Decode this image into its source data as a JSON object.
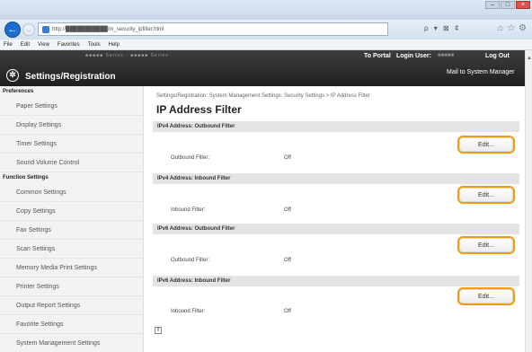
{
  "browser": {
    "url": "http://███████████/m_security_ipfilter.html",
    "search_controls": "ρ ▾ ⊠ ¢",
    "menu": [
      "File",
      "Edit",
      "View",
      "Favorites",
      "Tools",
      "Help"
    ],
    "window_buttons": [
      "–",
      "□",
      "×"
    ]
  },
  "header": {
    "model_text": "■■■■■ Series · ■■■■■ Series",
    "portal_label": "To Portal",
    "login_label": "Login User:",
    "login_user": "■■■■■",
    "logout_label": "Log Out",
    "mail_label": "Mail to System Manager",
    "app_title": "Settings/Registration"
  },
  "sidebar": {
    "sections": [
      {
        "title": "Preferences",
        "items": [
          "Paper Settings",
          "Display Settings",
          "Timer Settings",
          "Sound Volume Control"
        ]
      },
      {
        "title": "Function Settings",
        "items": [
          "Common Settings",
          "Copy Settings",
          "Fax Settings",
          "Scan Settings",
          "Memory Media Print Settings",
          "Printer Settings",
          "Output Report Settings",
          "Favorite Settings",
          "System Management Settings"
        ]
      }
    ]
  },
  "main": {
    "breadcrumb": "Settings/Registration: System Management Settings: Security Settings > IP Address Filter",
    "title": "IP Address Filter",
    "edit_label": "Edit...",
    "sections": [
      {
        "title": "IPv4 Address: Outbound Filter",
        "label": "Outbound Filter:",
        "value": "Off"
      },
      {
        "title": "IPv4 Address: Inbound Filter",
        "label": "Inbound Filter:",
        "value": "Off"
      },
      {
        "title": "IPv6 Address: Outbound Filter",
        "label": "Outbound Filter:",
        "value": "Off"
      },
      {
        "title": "IPv6 Address: Inbound Filter",
        "label": "Inbound Filter:",
        "value": "Off"
      }
    ]
  },
  "colors": {
    "edit_border": "#f39c12",
    "header_bg": "#2b2b2b",
    "nav_back": "#1c6fd1"
  }
}
